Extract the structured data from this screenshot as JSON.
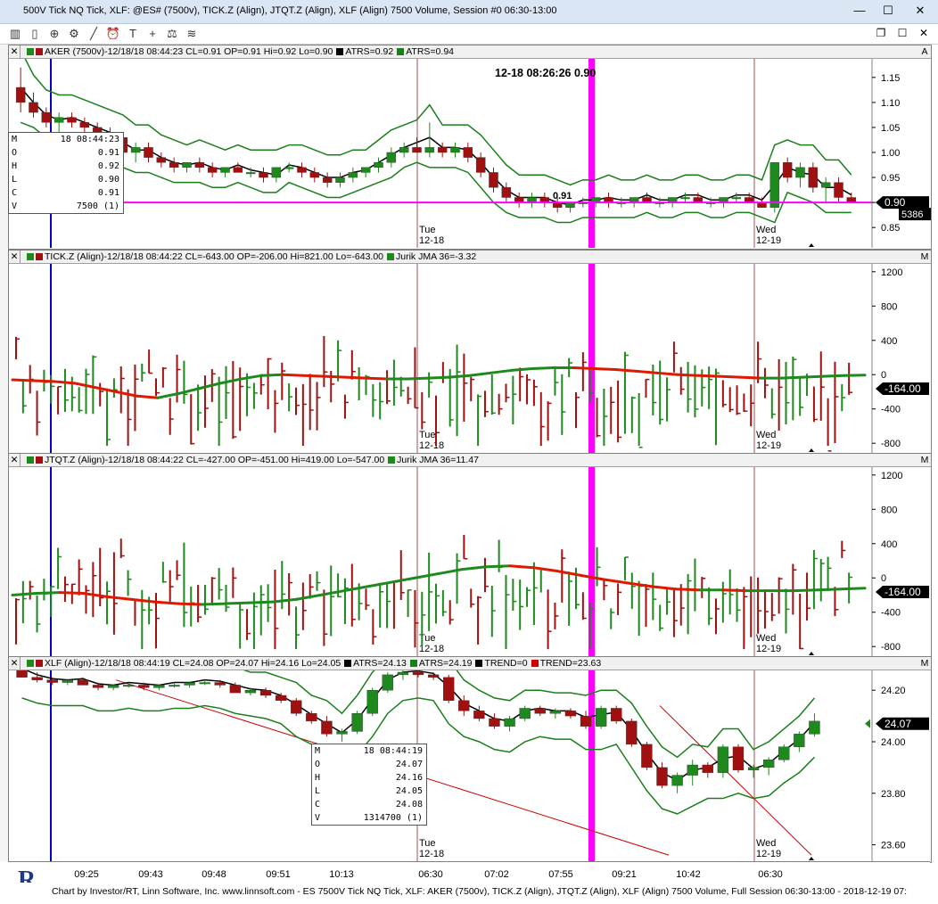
{
  "window": {
    "title": "500V Tick NQ Tick, XLF: @ES# (7500v), TICK.Z (Align), JTQT.Z (Align), XLF (Align) 7500 Volume, Session #0 06:30-13:00",
    "btn_min": "—",
    "btn_max": "☐",
    "btn_close": "✕",
    "mdi_restore": "❐",
    "mdi_max": "☐",
    "mdi_close": "✕"
  },
  "toolbar": [
    {
      "icon": "bar-chart-icon",
      "glyph": "▥"
    },
    {
      "icon": "candle-chart-icon",
      "glyph": "▯"
    },
    {
      "icon": "zoom-icon",
      "glyph": "⊕"
    },
    {
      "icon": "gear-icon",
      "glyph": "⚙"
    },
    {
      "icon": "draw-line-icon",
      "glyph": "╱"
    },
    {
      "icon": "alarm-clock-icon",
      "glyph": "⏰"
    },
    {
      "icon": "title-icon",
      "glyph": "T"
    },
    {
      "icon": "crosshair-icon",
      "glyph": "+"
    },
    {
      "icon": "balance-icon",
      "glyph": "⚖"
    },
    {
      "icon": "layers-icon",
      "glyph": "≋"
    }
  ],
  "colors": {
    "up": "#1e8a1e",
    "down": "#a01010",
    "jma_up": "#1e8a1e",
    "jma_down": "#dd1a00",
    "atr": "#1a7f1a",
    "trend": "#000000",
    "magenta": "#ff00ff",
    "blue": "#0000c8",
    "red_line": "#cc0000"
  },
  "crosshair": {
    "label": "12-18 08:26:26",
    "value": "0.90"
  },
  "panes": [
    {
      "id": "aker",
      "title": "AKER (7500v)-12/18/18 08:44:23 CL=0.91 OP=0.91 Hi=0.92 Lo=0.90",
      "legend": [
        {
          "text": "ATRS=0.92",
          "color": "#000000"
        },
        {
          "text": "ATRS=0.94",
          "color": "#1a7f1a"
        }
      ],
      "y_ticks": [
        "1.15",
        "1.10",
        "1.05",
        "1.00",
        "0.95",
        "0.90",
        "0.85"
      ],
      "last_value": "0.90",
      "volume": "5386",
      "partial_label": "0.91",
      "day_labels": [
        {
          "day": "Tue",
          "date": "12-18"
        },
        {
          "day": "Wed",
          "date": "12-19"
        }
      ]
    },
    {
      "id": "tick",
      "title": "TICK.Z (Align)-12/18/18 08:44:22 CL=-643.00 OP=-206.00 Hi=821.00 Lo=-643.00",
      "legend": [
        {
          "text": "Jurik JMA 36=-3.32",
          "color": "#1e8a1e"
        }
      ],
      "y_ticks": [
        "1200",
        "800",
        "400",
        "0",
        "-400",
        "-800"
      ],
      "last_value": "-164.00",
      "day_labels": [
        {
          "day": "Tue",
          "date": "12-18"
        },
        {
          "day": "Wed",
          "date": "12-19"
        }
      ]
    },
    {
      "id": "jtqt",
      "title": "JTQT.Z (Align)-12/18/18 08:44:22 CL=-427.00 OP=-451.00 Hi=419.00 Lo=-547.00",
      "legend": [
        {
          "text": "Jurik JMA 36=11.47",
          "color": "#1e8a1e"
        }
      ],
      "y_ticks": [
        "1200",
        "800",
        "400",
        "0",
        "-400",
        "-800"
      ],
      "last_value": "-164.00",
      "day_labels": [
        {
          "day": "Tue",
          "date": "12-18"
        },
        {
          "day": "Wed",
          "date": "12-19"
        }
      ]
    },
    {
      "id": "xlf",
      "title": "XLF (Align)-12/18/18 08:44:19 CL=24.08 OP=24.07 Hi=24.16 Lo=24.05",
      "legend": [
        {
          "text": "ATRS=24.13",
          "color": "#000000"
        },
        {
          "text": "ATRS=24.19",
          "color": "#1a7f1a"
        },
        {
          "text": "TREND=0",
          "color": "#000000"
        },
        {
          "text": "TREND=23.63",
          "color": "#cc0000"
        }
      ],
      "y_ticks": [
        "24.20",
        "24.00",
        "23.80",
        "23.60"
      ],
      "last_value": "24.07",
      "day_labels": [
        {
          "day": "Tue",
          "date": "12-18"
        },
        {
          "day": "Wed",
          "date": "12-19"
        }
      ]
    }
  ],
  "popups": [
    {
      "id": "aker-popup",
      "rows": [
        [
          "M",
          "18 08:44:23"
        ],
        [
          "O",
          "0.91"
        ],
        [
          "H",
          "0.92"
        ],
        [
          "L",
          "0.90"
        ],
        [
          "C",
          "0.91"
        ],
        [
          "V",
          "7500 (1)"
        ]
      ]
    },
    {
      "id": "xlf-popup",
      "rows": [
        [
          "M",
          "18 08:44:19"
        ],
        [
          "O",
          "24.07"
        ],
        [
          "H",
          "24.16"
        ],
        [
          "L",
          "24.05"
        ],
        [
          "C",
          "24.08"
        ],
        [
          "V",
          "1314700 (1)"
        ]
      ]
    }
  ],
  "time_axis": [
    "09:25",
    "09:43",
    "09:48",
    "09:51",
    "10:13",
    "06:30",
    "07:02",
    "07:55",
    "09:21",
    "10:42",
    "06:30"
  ],
  "footer": "Chart by Investor/RT, Linn Software, Inc. www.linnsoft.com - ES 7500V Tick NQ Tick, XLF: AKER (7500v), TICK.Z (Align), JTQT.Z (Align), XLF (Align) 7500 Volume, Full Session 06:30-13:00 - 2018-12-19 07:",
  "chart_data": [
    {
      "type": "candlestick",
      "name": "AKER (7500v)",
      "ylim": [
        0.82,
        1.18
      ],
      "x_session_breaks": [
        "Tue 12-18",
        "Wed 12-19"
      ],
      "ohlc": [
        [
          1.13,
          1.17,
          1.08,
          1.1
        ],
        [
          1.1,
          1.12,
          1.07,
          1.08
        ],
        [
          1.08,
          1.09,
          1.05,
          1.06
        ],
        [
          1.06,
          1.08,
          1.04,
          1.07
        ],
        [
          1.07,
          1.08,
          1.05,
          1.06
        ],
        [
          1.06,
          1.07,
          1.04,
          1.05
        ],
        [
          1.05,
          1.06,
          1.03,
          1.04
        ],
        [
          1.04,
          1.05,
          1.02,
          1.03
        ],
        [
          1.03,
          1.04,
          0.99,
          1.0
        ],
        [
          1.0,
          1.02,
          0.98,
          1.01
        ],
        [
          1.01,
          1.02,
          0.98,
          0.99
        ],
        [
          0.99,
          1.0,
          0.97,
          0.98
        ],
        [
          0.98,
          0.99,
          0.96,
          0.97
        ],
        [
          0.97,
          0.98,
          0.96,
          0.98
        ],
        [
          0.98,
          0.99,
          0.96,
          0.97
        ],
        [
          0.97,
          0.98,
          0.95,
          0.96
        ],
        [
          0.96,
          0.97,
          0.95,
          0.97
        ],
        [
          0.97,
          0.98,
          0.96,
          0.96
        ],
        [
          0.96,
          0.97,
          0.95,
          0.96
        ],
        [
          0.96,
          0.97,
          0.94,
          0.95
        ],
        [
          0.95,
          0.96,
          0.94,
          0.97
        ],
        [
          0.97,
          0.98,
          0.96,
          0.97
        ],
        [
          0.97,
          0.98,
          0.95,
          0.96
        ],
        [
          0.96,
          0.97,
          0.94,
          0.95
        ],
        [
          0.95,
          0.96,
          0.93,
          0.94
        ],
        [
          0.94,
          0.96,
          0.93,
          0.95
        ],
        [
          0.95,
          0.97,
          0.94,
          0.96
        ],
        [
          0.96,
          0.97,
          0.95,
          0.97
        ],
        [
          0.97,
          0.99,
          0.96,
          0.98
        ],
        [
          0.98,
          1.01,
          0.97,
          1.0
        ],
        [
          1.0,
          1.02,
          0.99,
          1.01
        ],
        [
          1.01,
          1.03,
          1.0,
          1.0
        ],
        [
          1.0,
          1.06,
          0.99,
          1.01
        ],
        [
          1.01,
          1.02,
          0.99,
          1.0
        ],
        [
          1.0,
          1.02,
          0.99,
          1.01
        ],
        [
          1.01,
          1.02,
          0.98,
          0.99
        ],
        [
          0.99,
          1.0,
          0.95,
          0.96
        ],
        [
          0.96,
          0.97,
          0.92,
          0.93
        ],
        [
          0.93,
          0.94,
          0.9,
          0.91
        ],
        [
          0.91,
          0.92,
          0.89,
          0.9
        ],
        [
          0.9,
          0.92,
          0.89,
          0.91
        ],
        [
          0.91,
          0.92,
          0.89,
          0.9
        ],
        [
          0.9,
          0.91,
          0.88,
          0.89
        ],
        [
          0.89,
          0.9,
          0.88,
          0.9
        ],
        [
          0.9,
          0.91,
          0.89,
          0.9
        ],
        [
          0.9,
          0.91,
          0.89,
          0.91
        ],
        [
          0.91,
          0.92,
          0.89,
          0.9
        ],
        [
          0.9,
          0.91,
          0.89,
          0.9
        ],
        [
          0.9,
          0.91,
          0.89,
          0.91
        ],
        [
          0.91,
          0.92,
          0.9,
          0.9
        ],
        [
          0.9,
          0.91,
          0.89,
          0.9
        ],
        [
          0.9,
          0.91,
          0.89,
          0.91
        ],
        [
          0.91,
          0.92,
          0.9,
          0.91
        ],
        [
          0.91,
          0.92,
          0.9,
          0.9
        ],
        [
          0.9,
          0.91,
          0.89,
          0.9
        ],
        [
          0.9,
          0.91,
          0.89,
          0.91
        ],
        [
          0.91,
          0.92,
          0.9,
          0.91
        ],
        [
          0.91,
          0.92,
          0.9,
          0.9
        ],
        [
          0.9,
          0.91,
          0.89,
          0.89
        ],
        [
          0.89,
          0.98,
          0.88,
          0.98
        ],
        [
          0.98,
          0.99,
          0.94,
          0.95
        ],
        [
          0.95,
          0.98,
          0.93,
          0.97
        ],
        [
          0.97,
          0.98,
          0.92,
          0.93
        ],
        [
          0.93,
          0.95,
          0.9,
          0.94
        ],
        [
          0.94,
          0.95,
          0.9,
          0.91
        ],
        [
          0.91,
          0.92,
          0.9,
          0.9
        ]
      ]
    },
    {
      "type": "bar",
      "name": "TICK.Z (Align)",
      "ylim": [
        -850,
        1250
      ],
      "jma_36": [
        -60,
        -70,
        -80,
        -100,
        -150,
        -200,
        -250,
        -270,
        -220,
        -160,
        -100,
        -50,
        -10,
        0,
        -10,
        -20,
        -30,
        -40,
        -50,
        -50,
        -40,
        -30,
        -10,
        20,
        50,
        70,
        80,
        80,
        70,
        60,
        40,
        20,
        0,
        -10,
        -20,
        -30,
        -40,
        -40,
        -30,
        -20,
        -10,
        -5
      ]
    },
    {
      "type": "bar",
      "name": "JTQT.Z (Align)",
      "ylim": [
        -850,
        1250
      ],
      "jma_36": [
        -200,
        -180,
        -170,
        -180,
        -220,
        -250,
        -280,
        -300,
        -310,
        -300,
        -290,
        -280,
        -250,
        -200,
        -150,
        -100,
        -50,
        0,
        50,
        100,
        130,
        140,
        120,
        80,
        30,
        -20,
        -60,
        -100,
        -130,
        -140,
        -140,
        -150,
        -150,
        -150,
        -140,
        -130,
        -120
      ]
    },
    {
      "type": "candlestick",
      "name": "XLF (Align)",
      "ylim": [
        23.55,
        24.27
      ],
      "ohlc": [
        [
          24.28,
          24.3,
          24.25,
          24.25
        ],
        [
          24.25,
          24.27,
          24.23,
          24.24
        ],
        [
          24.24,
          24.25,
          24.22,
          24.23
        ],
        [
          24.23,
          24.24,
          24.22,
          24.24
        ],
        [
          24.24,
          24.25,
          24.22,
          24.22
        ],
        [
          24.22,
          24.23,
          24.2,
          24.21
        ],
        [
          24.21,
          24.22,
          24.2,
          24.22
        ],
        [
          24.22,
          24.23,
          24.21,
          24.22
        ],
        [
          24.22,
          24.23,
          24.2,
          24.21
        ],
        [
          24.21,
          24.22,
          24.2,
          24.22
        ],
        [
          24.22,
          24.23,
          24.21,
          24.22
        ],
        [
          24.22,
          24.23,
          24.21,
          24.23
        ],
        [
          24.23,
          24.24,
          24.22,
          24.23
        ],
        [
          24.23,
          24.24,
          24.21,
          24.22
        ],
        [
          24.22,
          24.23,
          24.19,
          24.19
        ],
        [
          24.19,
          24.21,
          24.18,
          24.2
        ],
        [
          24.2,
          24.21,
          24.17,
          24.18
        ],
        [
          24.18,
          24.19,
          24.15,
          24.16
        ],
        [
          24.16,
          24.17,
          24.1,
          24.11
        ],
        [
          24.11,
          24.12,
          24.07,
          24.08
        ],
        [
          24.08,
          24.1,
          24.02,
          24.03
        ],
        [
          24.03,
          24.05,
          24.0,
          24.04
        ],
        [
          24.04,
          24.12,
          24.03,
          24.11
        ],
        [
          24.11,
          24.21,
          24.1,
          24.2
        ],
        [
          24.2,
          24.27,
          24.19,
          24.26
        ],
        [
          24.26,
          24.28,
          24.24,
          24.27
        ],
        [
          24.27,
          24.28,
          24.25,
          24.26
        ],
        [
          24.26,
          24.27,
          24.24,
          24.25
        ],
        [
          24.25,
          24.26,
          24.15,
          24.16
        ],
        [
          24.16,
          24.18,
          24.1,
          24.12
        ],
        [
          24.12,
          24.14,
          24.08,
          24.09
        ],
        [
          24.09,
          24.11,
          24.05,
          24.06
        ],
        [
          24.06,
          24.1,
          24.04,
          24.09
        ],
        [
          24.09,
          24.14,
          24.08,
          24.13
        ],
        [
          24.13,
          24.14,
          24.1,
          24.11
        ],
        [
          24.11,
          24.13,
          24.09,
          24.12
        ],
        [
          24.12,
          24.13,
          24.09,
          24.1
        ],
        [
          24.1,
          24.12,
          24.05,
          24.06
        ],
        [
          24.06,
          24.14,
          24.05,
          24.13
        ],
        [
          24.13,
          24.14,
          24.07,
          24.08
        ],
        [
          24.08,
          24.09,
          23.98,
          23.99
        ],
        [
          23.99,
          24.0,
          23.89,
          23.9
        ],
        [
          23.9,
          23.92,
          23.82,
          23.83
        ],
        [
          23.83,
          23.88,
          23.8,
          23.87
        ],
        [
          23.87,
          23.93,
          23.83,
          23.91
        ],
        [
          23.91,
          23.92,
          23.86,
          23.88
        ],
        [
          23.88,
          23.99,
          23.86,
          23.98
        ],
        [
          23.98,
          23.99,
          23.88,
          23.89
        ],
        [
          23.89,
          23.91,
          23.86,
          23.9
        ],
        [
          23.9,
          23.94,
          23.87,
          23.93
        ],
        [
          23.93,
          23.99,
          23.92,
          23.98
        ],
        [
          23.98,
          24.04,
          23.96,
          24.03
        ],
        [
          24.03,
          24.11,
          24.02,
          24.08
        ]
      ]
    }
  ]
}
